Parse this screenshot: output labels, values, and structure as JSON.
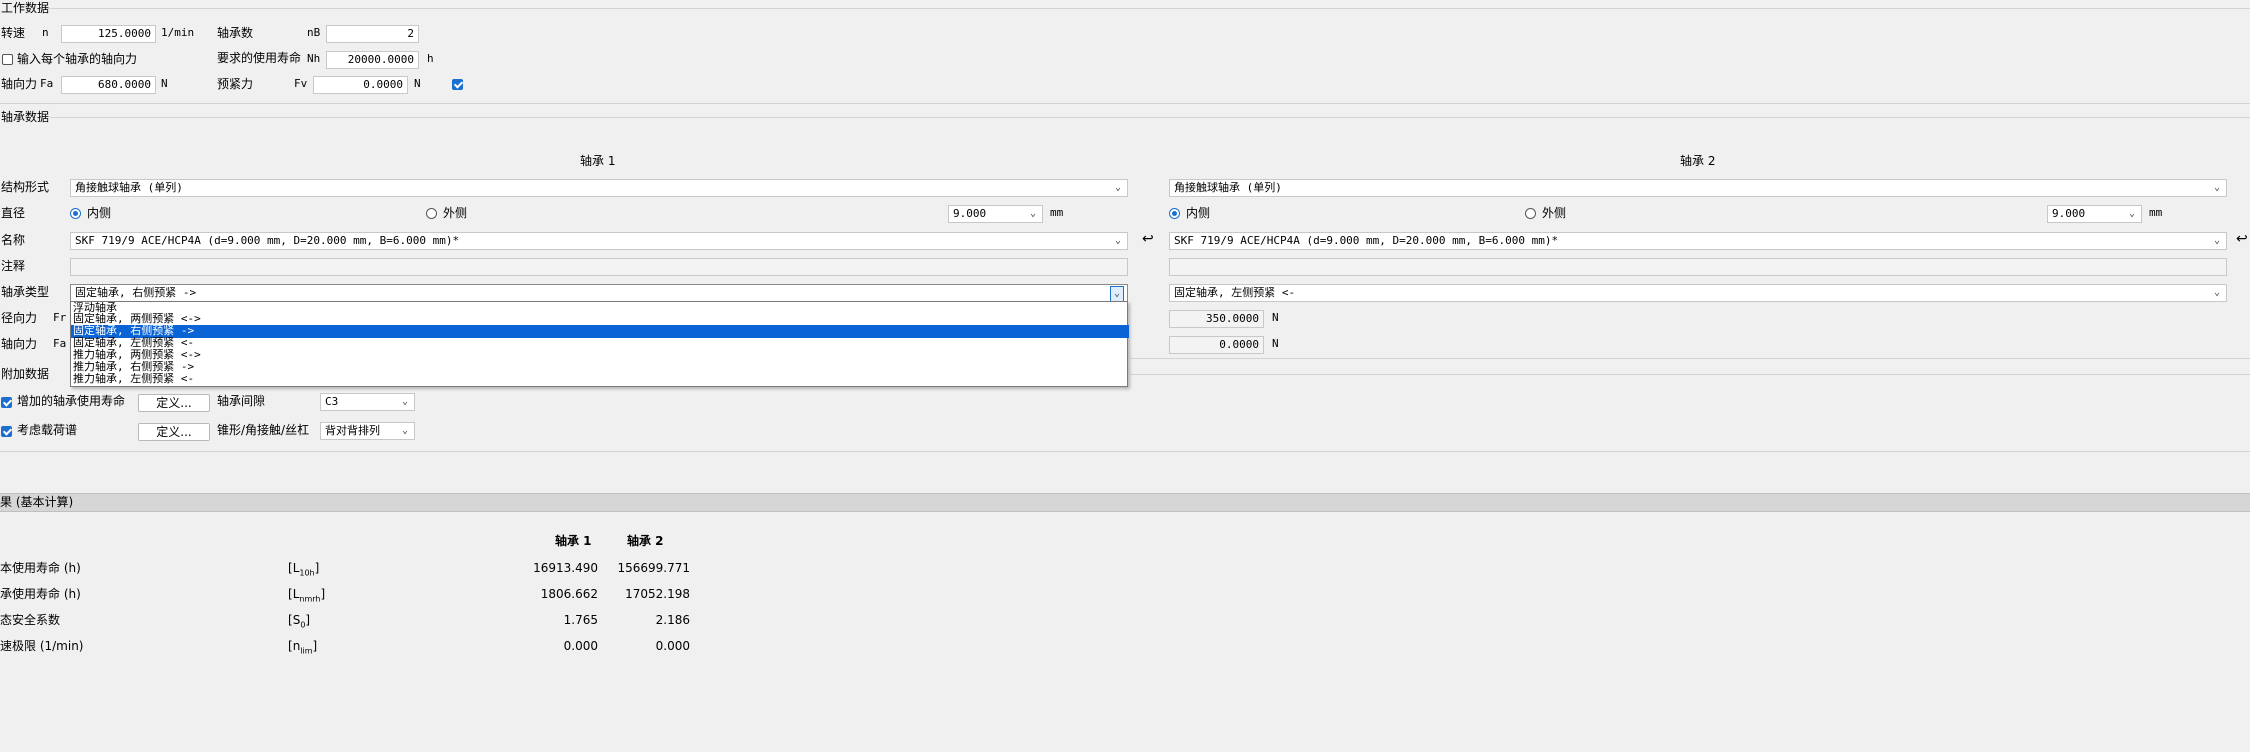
{
  "working_data": {
    "section_title": "工作数据",
    "speed_label": "转速",
    "speed_symbol": "n",
    "speed_value": "125.0000",
    "speed_unit": "1/min",
    "bearing_count_label": "轴承数",
    "bearing_count_symbol": "nB",
    "bearing_count_value": "2",
    "per_bearing_axial_label": "输入每个轴承的轴向力",
    "required_life_label": "要求的使用寿命",
    "required_life_symbol": "Nh",
    "required_life_value": "20000.0000",
    "required_life_unit": "h",
    "axial_force_label": "轴向力",
    "axial_force_symbol": "Fa",
    "axial_force_value": "680.0000",
    "axial_force_unit": "N",
    "preload_label": "预紧力",
    "preload_symbol": "Fv",
    "preload_value": "0.0000",
    "preload_unit": "N"
  },
  "bearing_data": {
    "section_title": "轴承数据",
    "col1_header": "轴承 1",
    "col2_header": "轴承 2",
    "structure_label": "结构形式",
    "diameter_label": "直径",
    "name_label": "名称",
    "note_label": "注释",
    "bearing_type_label": "轴承类型",
    "radial_label": "径向力",
    "radial_symbol": "Fr",
    "axial_label": "轴向力",
    "axial_symbol": "Fa",
    "unit_mm": "mm",
    "unit_n": "N",
    "b1": {
      "structure": "角接触球轴承 (单列)",
      "inner": "内侧",
      "outer": "外侧",
      "diameter": "9.000",
      "name": "SKF 719/9 ACE/HCP4A (d=9.000 mm, D=20.000 mm, B=6.000 mm)*",
      "type": "固定轴承, 右侧预紧 ->"
    },
    "b2": {
      "structure": "角接触球轴承 (单列)",
      "inner": "内侧",
      "outer": "外侧",
      "diameter": "9.000",
      "name": "SKF 719/9 ACE/HCP4A (d=9.000 mm, D=20.000 mm, B=6.000 mm)*",
      "type": "固定轴承, 左侧预紧 <-",
      "radial": "350.0000",
      "axial": "0.0000"
    },
    "arrow_glyph": "↩",
    "type_options": [
      "浮动轴承",
      "固定轴承, 两侧预紧 <->",
      "固定轴承, 右侧预紧 ->",
      "固定轴承, 左侧预紧 <-",
      "推力轴承, 两侧预紧 <->",
      "推力轴承, 右侧预紧 ->",
      "推力轴承, 左侧预紧 <-"
    ]
  },
  "additional": {
    "section_title": "附加数据",
    "extended_life_label": "增加的轴承使用寿命",
    "define_label": "定义...",
    "clearance_label": "轴承间隙",
    "clearance_value": "C3",
    "spectrum_label": "考虑载荷谱",
    "arrangement_label": "锥形/角接触/丝杠",
    "arrangement_value": "背对背排列"
  },
  "results": {
    "bar_title": "果 (基本计算)",
    "header_b1": "轴承 1",
    "header_b2": "轴承 2",
    "rows": [
      {
        "label": "本使用寿命 (h)",
        "sym_main": "L",
        "sym_sub": "10h",
        "v1": "16913.490",
        "v2": "156699.771"
      },
      {
        "label": "承使用寿命 (h)",
        "sym_main": "L",
        "sym_sub": "nmrh",
        "v1": "1806.662",
        "v2": "17052.198"
      },
      {
        "label": "态安全系数",
        "sym_main": "S",
        "sym_sub": "0",
        "v1": "1.765",
        "v2": "2.186"
      },
      {
        "label": "速极限 (1/min)",
        "sym_main": "n",
        "sym_sub": "lim",
        "v1": "0.000",
        "v2": "0.000"
      }
    ]
  },
  "colors": {
    "accent": "#1a6fcf",
    "selection": "#0a64d6",
    "background": "#f0f0f0"
  }
}
